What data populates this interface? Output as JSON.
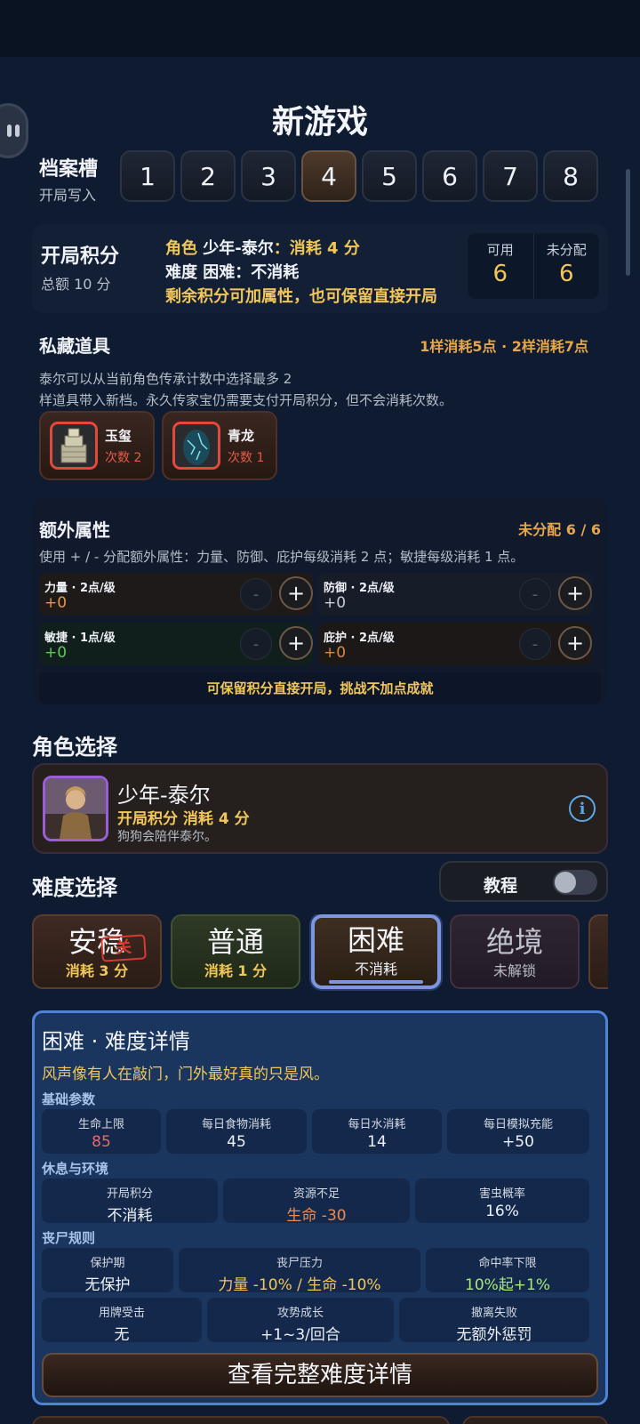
{
  "title": "新游戏",
  "slots": {
    "label": "档案槽",
    "sublabel": "开局写入",
    "items": [
      "1",
      "2",
      "3",
      "4",
      "5",
      "6",
      "7",
      "8"
    ],
    "selected": "4"
  },
  "points": {
    "title": "开局积分",
    "total": "总额 10 分",
    "line1_prefix": "角色",
    "line1_char": "少年-泰尔",
    "line1_suffix": "：消耗 4 分",
    "line2_prefix": "难度",
    "line2_diff": "困难",
    "line2_suffix": "：不消耗",
    "line3": "剩余积分可加属性，也可保留直接开局",
    "available_label": "可用",
    "available_value": "6",
    "unassigned_label": "未分配",
    "unassigned_value": "6"
  },
  "stash": {
    "title": "私藏道具",
    "cost_rule": "1样消耗5点 · 2样消耗7点",
    "desc_line1": "泰尔可以从当前角色传承计数中选择最多 2",
    "desc_line2": "样道具带入新档。永久传家宝仍需要支付开局积分，但不会消耗次数。",
    "items": [
      {
        "name": "玉玺",
        "count": "次数 2"
      },
      {
        "name": "青龙",
        "count": "次数 1"
      }
    ]
  },
  "attributes": {
    "title": "额外属性",
    "unassigned": "未分配 6 / 6",
    "desc": "使用 + / - 分配额外属性：力量、防御、庇护每级消耗 2 点；敏捷每级消耗 1 点。",
    "items": [
      {
        "label": "力量 · 2点/级",
        "value": "+0",
        "color": "#e8973a"
      },
      {
        "label": "防御 · 2点/级",
        "value": "+0",
        "color": "#c8ccd4"
      },
      {
        "label": "敏捷 · 1点/级",
        "value": "+0",
        "color": "#5fc85a"
      },
      {
        "label": "庇护 · 2点/级",
        "value": "+0",
        "color": "#d88a3a"
      }
    ],
    "minus": "-",
    "plus": "+",
    "note": "可保留积分直接开局，挑战不加点成就"
  },
  "character": {
    "title": "角色选择",
    "name": "少年-泰尔",
    "cost": "开局积分 消耗 4 分",
    "desc": "狗狗会陪伴泰尔。",
    "info_icon": "info-icon"
  },
  "difficulty": {
    "title": "难度选择",
    "tutorial_label": "教程",
    "tutorial_on": false,
    "options": [
      {
        "name": "安稳",
        "sub": "消耗 3 分",
        "badge": "关"
      },
      {
        "name": "普通",
        "sub": "消耗 1 分"
      },
      {
        "name": "困难",
        "sub": "不消耗"
      },
      {
        "name": "绝境",
        "sub": "未解锁"
      }
    ],
    "selected": "困难"
  },
  "detail": {
    "title": "困难 · 难度详情",
    "quote": "风声像有人在敲门，门外最好真的只是风。",
    "groups": [
      {
        "name": "基础参数",
        "cells": [
          {
            "label": "生命上限",
            "value": "85",
            "color": "#e86a6a"
          },
          {
            "label": "每日食物消耗",
            "value": "45",
            "color": "#eef1f6"
          },
          {
            "label": "每日水消耗",
            "value": "14",
            "color": "#eef1f6"
          },
          {
            "label": "每日模拟充能",
            "value": "+50",
            "color": "#eef1f6"
          }
        ]
      },
      {
        "name": "休息与环境",
        "cells": [
          {
            "label": "开局积分",
            "value": "不消耗",
            "color": "#eef1f6"
          },
          {
            "label": "资源不足",
            "value": "生命 -30",
            "color": "#f08a50"
          },
          {
            "label": "害虫概率",
            "value": "16%",
            "color": "#eef1f6"
          }
        ]
      },
      {
        "name": "丧尸规则",
        "cells": [
          {
            "label": "保护期",
            "value": "无保护",
            "color": "#eef1f6"
          },
          {
            "label": "丧尸压力",
            "value": "力量 -10% / 生命 -10%",
            "color": "#f2c75a"
          },
          {
            "label": "命中率下限",
            "value": "10%起+1%",
            "color": "#a8e87a"
          },
          {
            "label": "用牌受击",
            "value": "无",
            "color": "#eef1f6"
          },
          {
            "label": "攻势成长",
            "value": "+1~3/回合",
            "color": "#eef1f6"
          },
          {
            "label": "撤离失败",
            "value": "无额外惩罚",
            "color": "#eef1f6"
          }
        ]
      }
    ],
    "full_button": "查看完整难度详情"
  }
}
